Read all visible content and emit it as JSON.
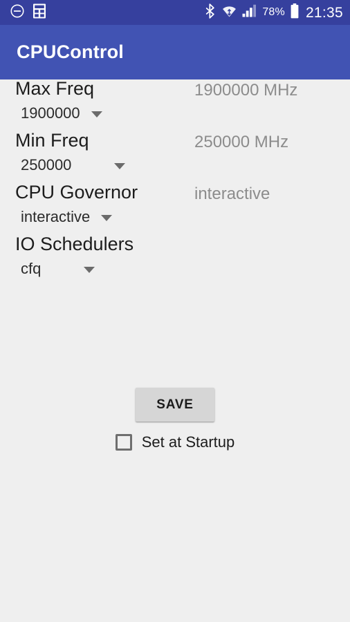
{
  "statusbar": {
    "left_icons": [
      {
        "name": "do-not-disturb-icon"
      },
      {
        "name": "calculator-icon"
      }
    ],
    "right_icons": [
      {
        "name": "bluetooth-icon"
      },
      {
        "name": "wifi-icon"
      },
      {
        "name": "cellular-signal-icon"
      }
    ],
    "battery_percent": "78%",
    "battery_icon": "battery-icon",
    "clock": "21:35"
  },
  "appbar": {
    "title": "CPUControl"
  },
  "settings": [
    {
      "label": "Max Freq",
      "selected": "1900000",
      "current": "1900000 MHz",
      "caret": "chevron-down-icon"
    },
    {
      "label": "Min Freq",
      "selected": "250000",
      "current": "250000 MHz",
      "caret": "chevron-down-icon"
    },
    {
      "label": "CPU Governor",
      "selected": "interactive",
      "current": "interactive",
      "caret": "chevron-down-icon"
    },
    {
      "label": "IO Schedulers",
      "selected": "cfq",
      "current": "",
      "caret": "chevron-down-icon"
    }
  ],
  "save_button": {
    "label": "SAVE"
  },
  "startup_checkbox": {
    "label": "Set at Startup",
    "checked": false
  },
  "colors": {
    "statusbar_bg": "#36409e",
    "appbar_bg": "#4153b3",
    "page_bg": "#efefef",
    "label_text": "#1c1c1c",
    "muted_text": "#8c8c8c",
    "button_bg": "#d6d6d6"
  }
}
